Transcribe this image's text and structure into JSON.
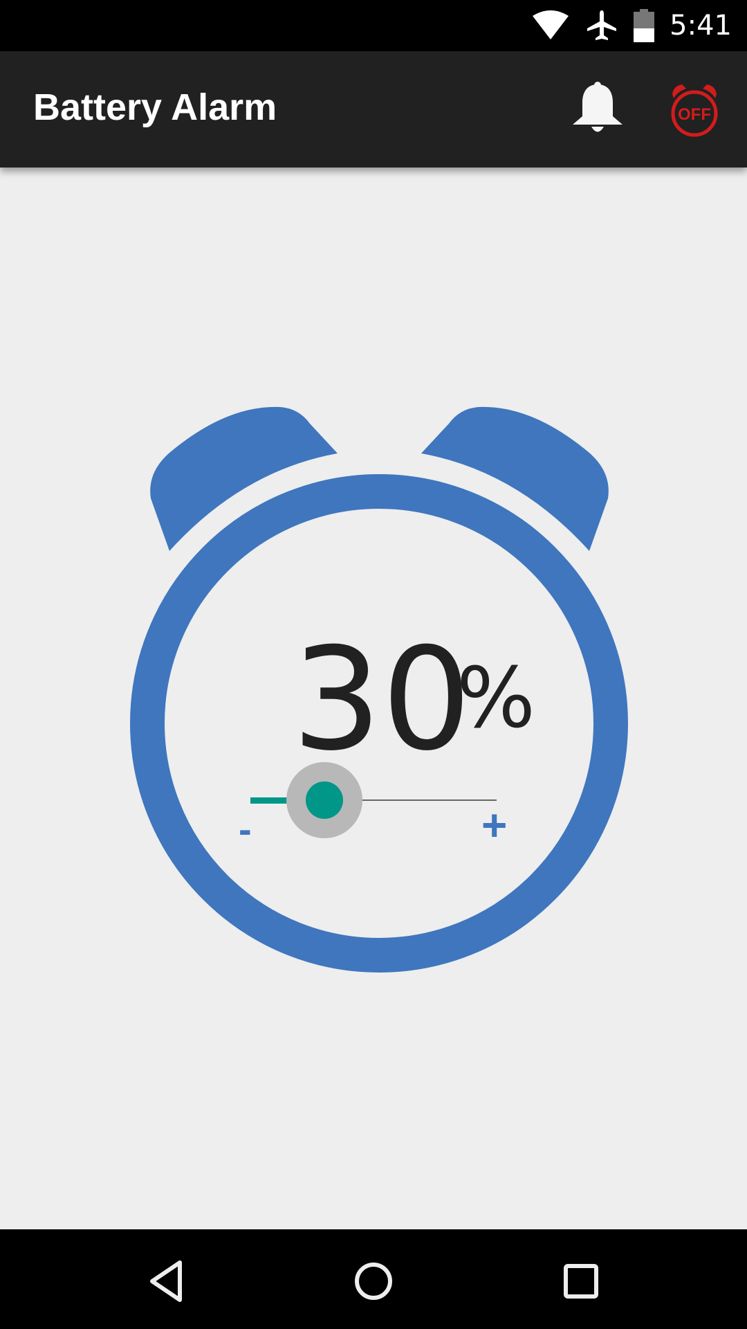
{
  "status_bar": {
    "time": "5:41",
    "icons": [
      "wifi-icon",
      "airplane-mode-icon",
      "battery-icon"
    ],
    "battery_level_percent": 45
  },
  "app_bar": {
    "title": "Battery Alarm",
    "actions": [
      {
        "name": "notification-bell",
        "icon": "bell-icon"
      },
      {
        "name": "alarm-off-toggle",
        "icon": "alarm-clock-off-icon",
        "label": "OFF",
        "color": "#d31c1c"
      }
    ]
  },
  "main": {
    "threshold_value": "30",
    "threshold_unit": "%",
    "slider": {
      "value_percent": 30,
      "minus_label": "-",
      "plus_label": "+"
    },
    "colors": {
      "clock": "#3f76be",
      "slider_accent": "#009688",
      "background": "#eeeeee"
    }
  },
  "nav_bar": {
    "buttons": [
      "back",
      "home",
      "recents"
    ]
  }
}
